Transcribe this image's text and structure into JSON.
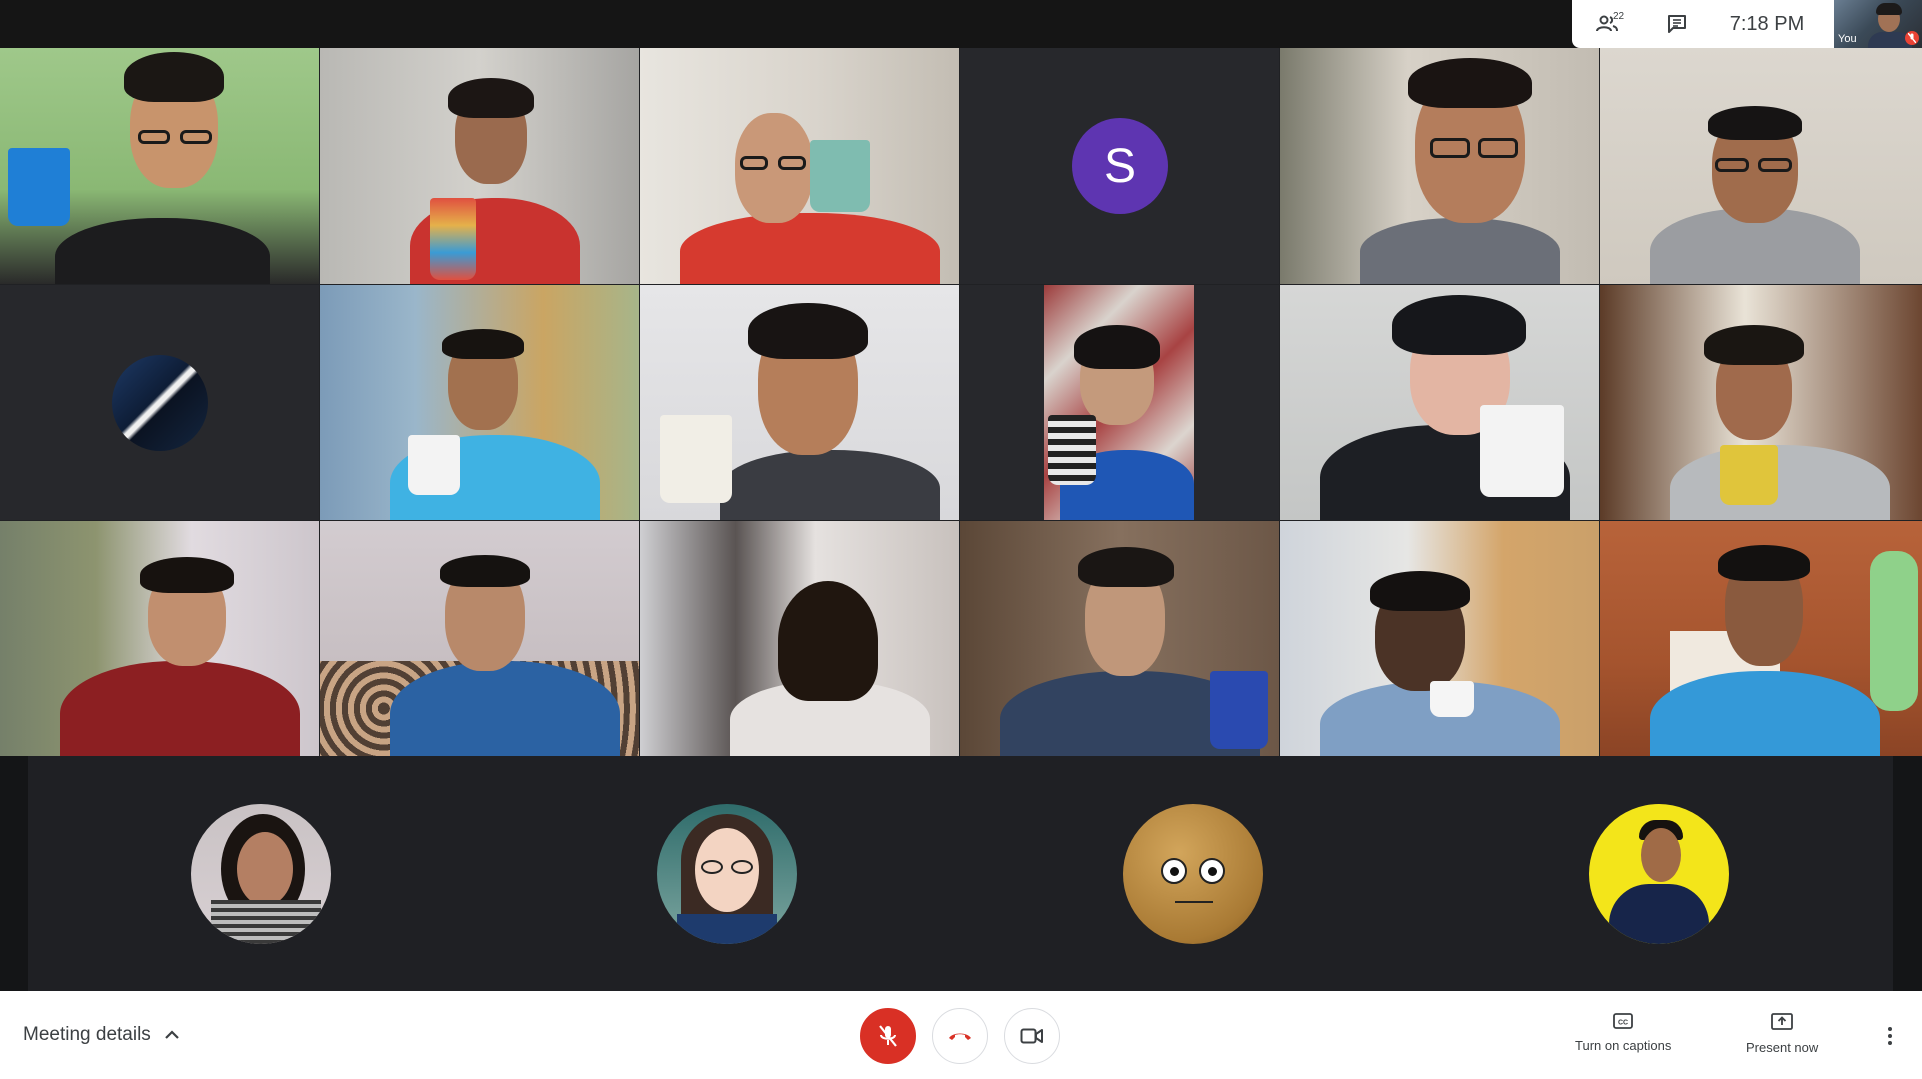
{
  "info_bar": {
    "participants_count": "22",
    "participants_icon": "people-icon",
    "chat_icon": "chat-icon",
    "time": "7:18 PM",
    "self_label": "You",
    "self_mic_icon": "mic-off-icon"
  },
  "tiles": [
    {
      "id": "tile-1",
      "type": "video"
    },
    {
      "id": "tile-2",
      "type": "video"
    },
    {
      "id": "tile-3",
      "type": "video"
    },
    {
      "id": "tile-4",
      "type": "letter",
      "letter": "S",
      "color": "#5e35b1"
    },
    {
      "id": "tile-5",
      "type": "video"
    },
    {
      "id": "tile-6",
      "type": "video"
    },
    {
      "id": "tile-7",
      "type": "avatar"
    },
    {
      "id": "tile-8",
      "type": "video"
    },
    {
      "id": "tile-9",
      "type": "video"
    },
    {
      "id": "tile-10",
      "type": "video"
    },
    {
      "id": "tile-11",
      "type": "video"
    },
    {
      "id": "tile-12",
      "type": "video"
    },
    {
      "id": "tile-13",
      "type": "video"
    },
    {
      "id": "tile-14",
      "type": "video"
    },
    {
      "id": "tile-15",
      "type": "video"
    },
    {
      "id": "tile-16",
      "type": "video"
    },
    {
      "id": "tile-17",
      "type": "video"
    },
    {
      "id": "tile-18",
      "type": "video"
    }
  ],
  "bottom_avatars": [
    {
      "name": "avatar-photo-woman"
    },
    {
      "name": "avatar-cartoon-woman"
    },
    {
      "name": "avatar-potato"
    },
    {
      "name": "avatar-yellow-man"
    }
  ],
  "controls": {
    "meeting_details": "Meeting details",
    "mic_icon": "mic-off-icon",
    "hangup_icon": "hangup-icon",
    "camera_icon": "camera-icon",
    "captions_label": "Turn on captions",
    "present_label": "Present now",
    "more_icon": "more-vert-icon",
    "colors": {
      "mic_off_bg": "#d93025",
      "hangup_red": "#d93025",
      "letter_avatar": "#5e35b1"
    }
  }
}
